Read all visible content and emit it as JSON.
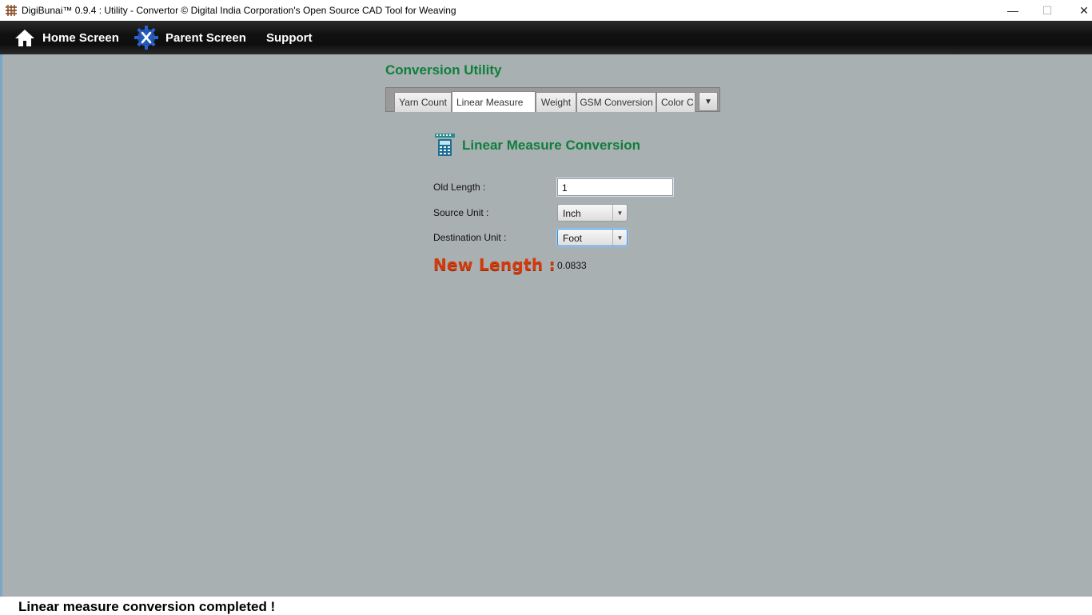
{
  "window": {
    "title": "DigiBunai™ 0.9.4 : Utility - Convertor © Digital India Corporation's Open Source CAD Tool for Weaving",
    "minimize_icon": "minimize-icon",
    "maximize_icon": "maximize-icon",
    "close_icon": "close-icon"
  },
  "menu": {
    "home_label": "Home Screen",
    "parent_label": "Parent Screen",
    "support_label": "Support"
  },
  "page": {
    "heading": "Conversion Utility"
  },
  "tabs": [
    {
      "label": "Yarn Count",
      "active": false
    },
    {
      "label": "Linear Measure",
      "active": true
    },
    {
      "label": "Weight",
      "active": false
    },
    {
      "label": "GSM Conversion",
      "active": false
    },
    {
      "label": "Color C",
      "active": false
    }
  ],
  "section": {
    "title": "Linear Measure Conversion",
    "icon": "calculator-icon"
  },
  "form": {
    "old_length_label": "Old Length :",
    "old_length_value": "1",
    "source_unit_label": "Source Unit :",
    "source_unit_value": "Inch",
    "destination_unit_label": "Destination Unit :",
    "destination_unit_value": "Foot",
    "new_length_label": "New Length :",
    "new_length_value": "0.0833"
  },
  "status": {
    "message": "Linear measure conversion completed !"
  },
  "colors": {
    "heading_green": "#0e7f3a",
    "result_red": "#d23a0c",
    "content_bg": "#a9b0b2"
  }
}
